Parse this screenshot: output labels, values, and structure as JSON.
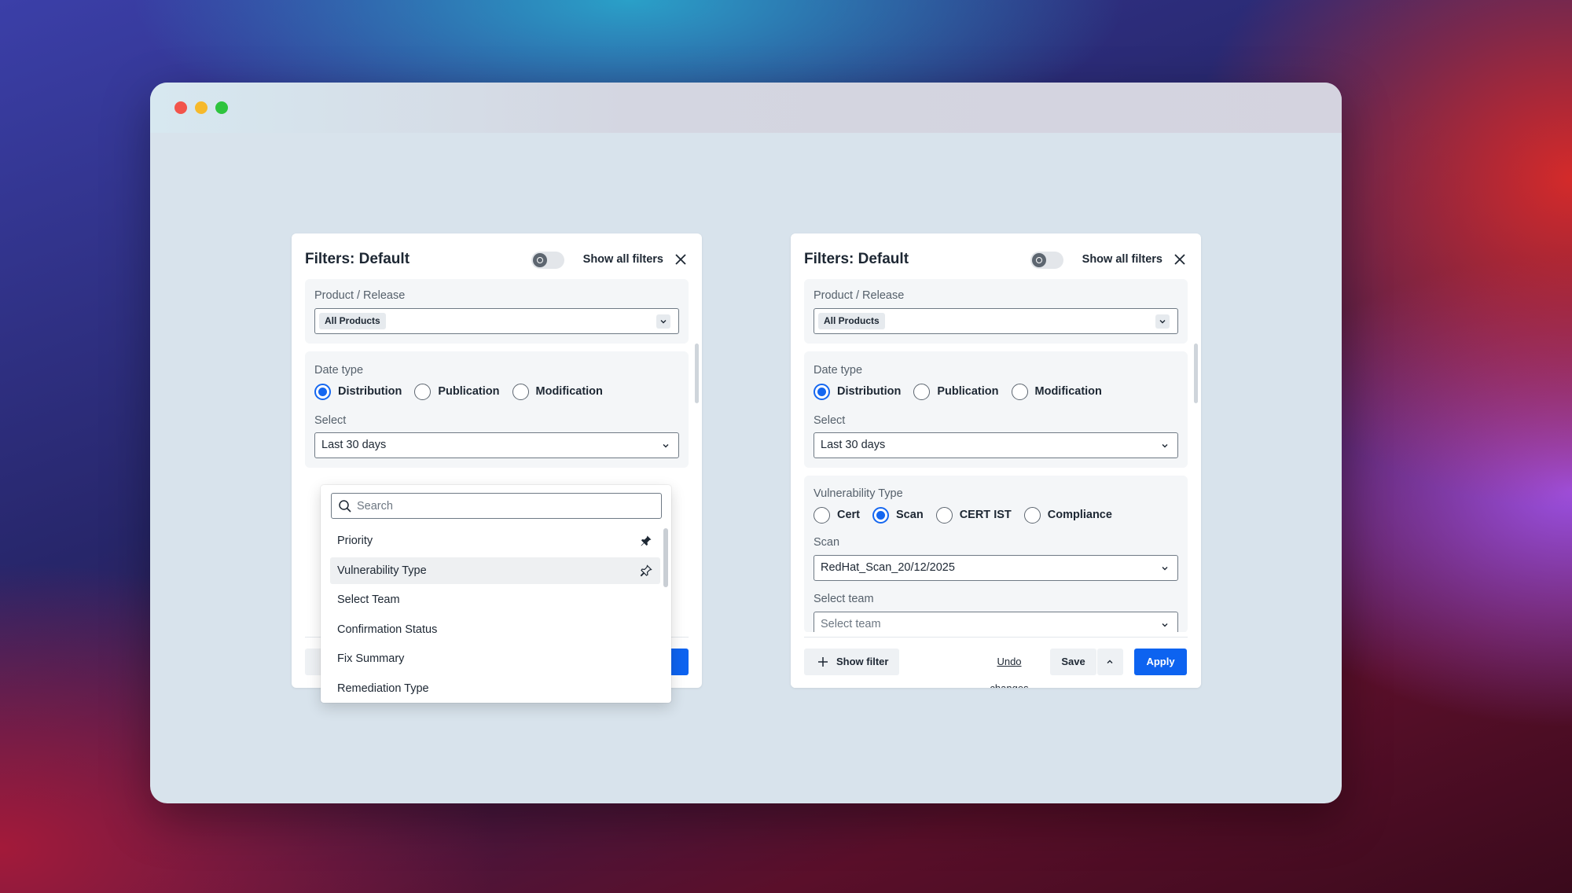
{
  "window": {
    "controls": [
      "close",
      "minimize",
      "zoom"
    ]
  },
  "left_panel": {
    "title": "Filters: Default",
    "show_all_label": "Show all filters",
    "product_label": "Product / Release",
    "product_chip": "All Products",
    "date_type_label": "Date type",
    "date_options": [
      "Distribution",
      "Publication",
      "Modification"
    ],
    "date_selected": "Distribution",
    "select_label": "Select",
    "select_value": "Last 30 days"
  },
  "dropdown": {
    "search_placeholder": "Search",
    "items": [
      {
        "label": "Priority",
        "pin": "pinned"
      },
      {
        "label": "Vulnerability Type",
        "pin": "unpinned"
      },
      {
        "label": "Select Team"
      },
      {
        "label": "Confirmation Status"
      },
      {
        "label": "Fix Summary"
      },
      {
        "label": "Remediation Type"
      }
    ]
  },
  "right_panel": {
    "title": "Filters: Default",
    "show_all_label": "Show all filters",
    "product_label": "Product / Release",
    "product_chip": "All Products",
    "date_type_label": "Date type",
    "date_options": [
      "Distribution",
      "Publication",
      "Modification"
    ],
    "date_selected": "Distribution",
    "select_label": "Select",
    "select_value": "Last 30 days",
    "vuln_type_label": "Vulnerability Type",
    "vuln_options": [
      "Cert",
      "Scan",
      "CERT IST",
      "Compliance"
    ],
    "vuln_selected": "Scan",
    "scan_label": "Scan",
    "scan_value": "RedHat_Scan_20/12/2025",
    "team_label": "Select team",
    "team_placeholder": "Select team",
    "footer": {
      "show_filter": "Show filter",
      "undo": "Undo changes",
      "save": "Save",
      "apply": "Apply"
    }
  },
  "colors": {
    "accent": "#0d63f0",
    "window_bg": "#d8e3ec"
  }
}
